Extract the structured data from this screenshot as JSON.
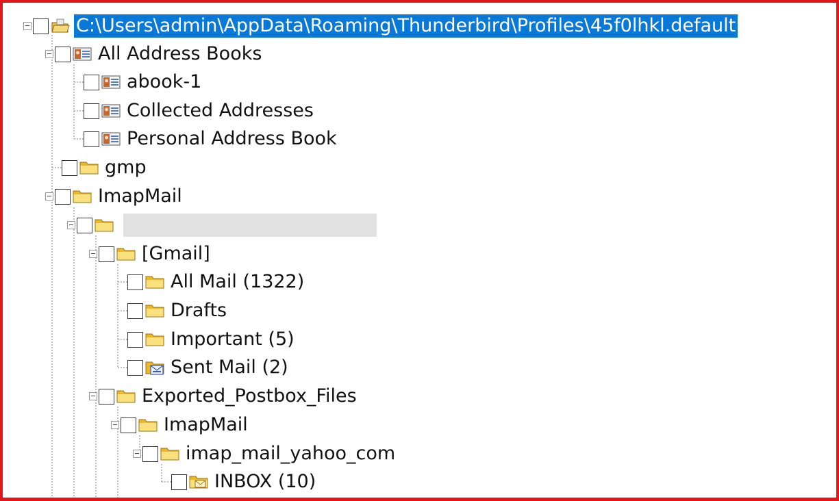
{
  "tree": {
    "root": {
      "label": "C:\\Users\\admin\\AppData\\Roaming\\Thunderbird\\Profiles\\45f0lhkl.default"
    },
    "all_address_books": {
      "label": "All Address Books",
      "children": [
        "abook-1",
        "Collected Addresses",
        "Personal Address Book"
      ]
    },
    "gmp": {
      "label": "gmp"
    },
    "imapmail": {
      "label": "ImapMail"
    },
    "gmail": {
      "label": "[Gmail]",
      "children": [
        "All Mail (1322)",
        "Drafts",
        "Important (5)",
        "Sent Mail (2)"
      ]
    },
    "exported": {
      "label": "Exported_Postbox_Files"
    },
    "exported_imapmail": {
      "label": "ImapMail"
    },
    "yahoo": {
      "label": "imap_mail_yahoo_com"
    },
    "inbox": {
      "label": "INBOX (10)"
    }
  },
  "icons": {
    "profile": "profile-folder-icon",
    "address_book": "address-book-icon",
    "folder": "folder-icon",
    "sent": "sent-mail-icon",
    "inbox": "inbox-folder-icon"
  },
  "colors": {
    "selection": "#0a78d7",
    "frame_border": "#e3161b",
    "folder_yellow": "#f5d24a",
    "redaction": "#e1e1e1"
  }
}
